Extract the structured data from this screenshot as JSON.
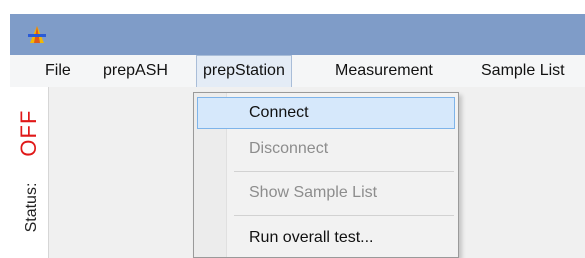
{
  "menu": {
    "items": [
      "File",
      "prepASH",
      "prepStation",
      "Measurement",
      "Sample List"
    ],
    "active_index": 2
  },
  "status": {
    "label": "Status:",
    "value": "OFF",
    "value_color": "#e01818"
  },
  "dropdown": {
    "items": [
      {
        "label": "Connect",
        "enabled": true,
        "highlighted": true
      },
      {
        "label": "Disconnect",
        "enabled": false
      },
      {
        "label": "Show Sample List",
        "enabled": false
      },
      {
        "label": "Run overall test...",
        "enabled": true
      }
    ]
  },
  "colors": {
    "titlebar": "#7f9cc8",
    "menu_highlight": "#d6e8fb"
  },
  "icons": {
    "app_icon": "app-logo-icon"
  }
}
